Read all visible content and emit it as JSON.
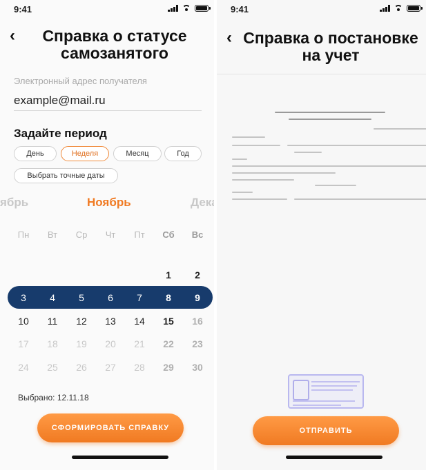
{
  "status_bar": {
    "time": "9:41"
  },
  "left_screen": {
    "title_line1": "Справка о статусе",
    "title_line2": "самозанятого",
    "email": {
      "label": "Электронный адрес получателя",
      "value": "example@mail.ru"
    },
    "period_title": "Задайте период",
    "period_options": [
      {
        "label": "День",
        "active": false
      },
      {
        "label": "Неделя",
        "active": true
      },
      {
        "label": "Месяц",
        "active": false
      },
      {
        "label": "Год",
        "active": false
      }
    ],
    "exact_dates_label": "Выбрать точные даты",
    "months": {
      "prev": "ябрь",
      "current": "Ноябрь",
      "next": "Дека"
    },
    "weekdays": [
      "Пн",
      "Вт",
      "Ср",
      "Чт",
      "Пт",
      "Сб",
      "Вс"
    ],
    "calendar_rows": [
      [
        "",
        "",
        "",
        "",
        "",
        "1",
        "2"
      ],
      [
        "3",
        "4",
        "5",
        "6",
        "7",
        "8",
        "9"
      ],
      [
        "10",
        "11",
        "12",
        "13",
        "14",
        "15",
        "16"
      ],
      [
        "17",
        "18",
        "19",
        "20",
        "21",
        "22",
        "23"
      ],
      [
        "24",
        "25",
        "26",
        "27",
        "28",
        "29",
        "30"
      ]
    ],
    "selected_week_row": 1,
    "selected_text": "Выбрано: 12.11.18",
    "submit_label": "СФОРМИРОВАТЬ СПРАВКУ"
  },
  "right_screen": {
    "title_line1": "Справка о постановке",
    "title_line2": "на учет",
    "send_label": "ОТПРАВИТЬ"
  },
  "colors": {
    "accent": "#f07a22",
    "selected_week": "#173b6c",
    "inactive_text": "#c8c8c8"
  }
}
